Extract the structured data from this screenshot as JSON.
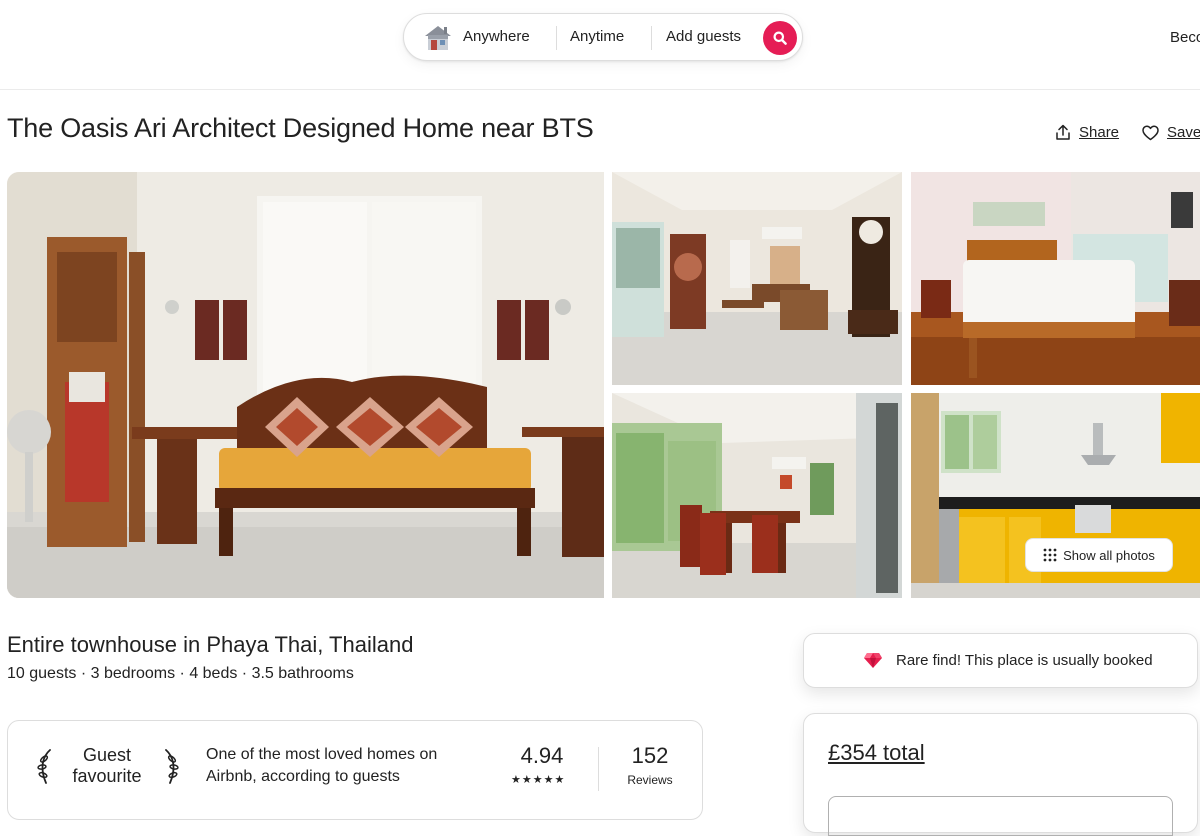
{
  "header": {
    "search": {
      "location_label": "Anywhere",
      "dates_label": "Anytime",
      "guests_label": "Add guests",
      "search_icon": "search-icon",
      "house_icon": "house-icon"
    },
    "become_host_label": "Beco"
  },
  "listing": {
    "title": "The Oasis Ari Architect Designed Home near BTS",
    "share_label": "Share",
    "save_label": "Save",
    "show_all_photos_label": "Show all photos",
    "subtitle": "Entire townhouse in Phaya Thai, Thailand",
    "details": "10 guests · 3 bedrooms · 4 beds · 3.5 bathrooms",
    "photos": [
      {
        "icon": "living-room-photo"
      },
      {
        "icon": "lounge-photo"
      },
      {
        "icon": "bedroom-photo"
      },
      {
        "icon": "dining-room-photo"
      },
      {
        "icon": "kitchen-photo"
      }
    ]
  },
  "guest_favourite": {
    "badge_line1": "Guest",
    "badge_line2": "favourite",
    "description": "One of the most loved homes on Airbnb, according to guests",
    "rating": "4.94",
    "stars": "★★★★★",
    "reviews_count": "152",
    "reviews_label": "Reviews"
  },
  "sidebar": {
    "rare_find_text": "Rare find! This place is usually booked",
    "price_total": "£354 total"
  },
  "colors": {
    "brand": "#e51d55",
    "text": "#222222",
    "border": "#dddddd",
    "gem": "#e61e4d"
  }
}
